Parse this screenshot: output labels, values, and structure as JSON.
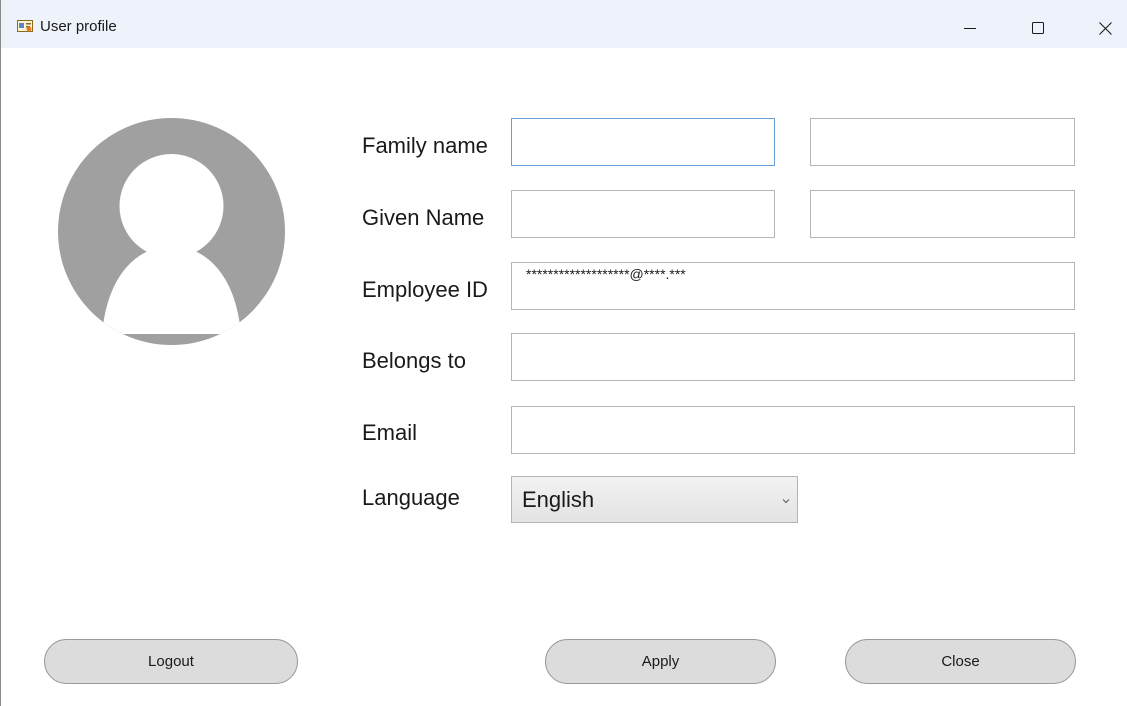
{
  "window": {
    "title": "User profile",
    "icon": "user-card-icon",
    "controls": {
      "minimize_icon": "minimize-icon",
      "maximize_icon": "maximize-icon",
      "close_icon": "close-icon"
    }
  },
  "avatar": {
    "icon": "user-avatar-icon",
    "color": "#a0a0a0"
  },
  "form": {
    "family_name": {
      "label": "Family name",
      "value_primary": "",
      "value_secondary": ""
    },
    "given_name": {
      "label": "Given Name",
      "value_primary": "",
      "value_secondary": ""
    },
    "employee_id": {
      "label": "Employee ID",
      "value": "*******************@****.***"
    },
    "belongs_to": {
      "label": "Belongs to",
      "value": ""
    },
    "email": {
      "label": "Email",
      "value": ""
    },
    "language": {
      "label": "Language",
      "selected": "English",
      "arrow_icon": "chevron-down-icon"
    }
  },
  "buttons": {
    "logout": "Logout",
    "apply": "Apply",
    "close": "Close"
  },
  "colors": {
    "titlebar_bg": "#eef3fb",
    "focus_border": "#6a9fd8",
    "button_bg": "#dcdcdc"
  }
}
